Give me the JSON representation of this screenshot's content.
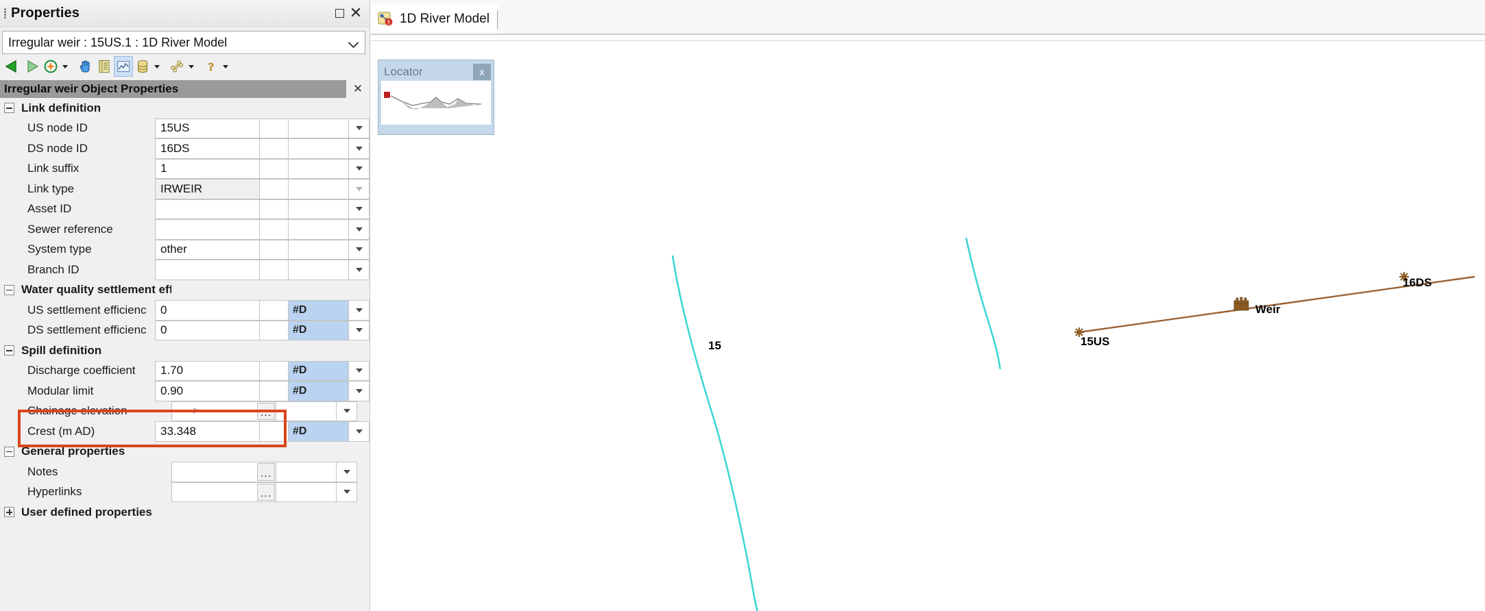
{
  "properties_panel": {
    "title": "Properties",
    "restore_icon": "restore-window-icon",
    "close_icon": "close-icon",
    "object_selector": {
      "value": "Irregular weir : 15US.1 : 1D River Model",
      "chevron_icon": "chevron-down-icon"
    },
    "toolbar": [
      {
        "name": "previous-object-button",
        "icon": "left-triangle-icon",
        "label": "Previous"
      },
      {
        "name": "next-object-button",
        "icon": "right-triangle-icon",
        "label": "Next"
      },
      {
        "name": "locate-object-button",
        "icon": "compass-icon",
        "label": "Locate"
      },
      {
        "name": "locate-dropdown",
        "icon": "chevron-down-icon",
        "label": ""
      },
      {
        "name": "select-object-button",
        "icon": "hand-pointer-icon",
        "label": "Select"
      },
      {
        "name": "open-form-button",
        "icon": "form-document-icon",
        "label": "Open form"
      },
      {
        "name": "graph-button",
        "icon": "graph-icon",
        "label": "Graph"
      },
      {
        "name": "database-button",
        "icon": "database-icon",
        "label": "Database"
      },
      {
        "name": "database-dropdown",
        "icon": "chevron-down-icon",
        "label": ""
      },
      {
        "name": "tools-button",
        "icon": "wrench-icon",
        "label": "Tools"
      },
      {
        "name": "tools-dropdown",
        "icon": "chevron-down-icon",
        "label": ""
      },
      {
        "name": "help-button",
        "icon": "help-question-icon",
        "label": "Help"
      },
      {
        "name": "help-dropdown",
        "icon": "chevron-down-icon",
        "label": ""
      }
    ],
    "object_properties_header": {
      "label": "Irregular weir Object Properties",
      "close_icon": "close-icon"
    },
    "highlight_color": "#d9461b",
    "badge_color": "#b9d3f0",
    "sections": [
      {
        "label": "Link definition",
        "expanded": true,
        "rows": [
          {
            "label": "US node ID",
            "value": "15US",
            "badge": "",
            "readonly": false,
            "ellipsis": false,
            "arrow": "enabled"
          },
          {
            "label": "DS node ID",
            "value": "16DS",
            "badge": "",
            "readonly": false,
            "ellipsis": false,
            "arrow": "enabled"
          },
          {
            "label": "Link suffix",
            "value": "1",
            "badge": "",
            "readonly": false,
            "ellipsis": false,
            "arrow": "enabled"
          },
          {
            "label": "Link type",
            "value": "IRWEIR",
            "badge": "",
            "readonly": true,
            "ellipsis": false,
            "arrow": "disabled"
          },
          {
            "label": "Asset ID",
            "value": "",
            "badge": "",
            "readonly": false,
            "ellipsis": false,
            "arrow": "enabled"
          },
          {
            "label": "Sewer reference",
            "value": "",
            "badge": "",
            "readonly": false,
            "ellipsis": false,
            "arrow": "enabled"
          },
          {
            "label": "System type",
            "value": "other",
            "badge": "",
            "readonly": false,
            "ellipsis": false,
            "arrow": "enabled"
          },
          {
            "label": "Branch ID",
            "value": "",
            "badge": "",
            "readonly": false,
            "ellipsis": false,
            "arrow": "enabled"
          }
        ]
      },
      {
        "label": "Water quality settlement efficiency",
        "expanded": true,
        "rows": [
          {
            "label": "US settlement efficienc",
            "value": "0",
            "badge": "#D",
            "readonly": false,
            "ellipsis": false,
            "arrow": "enabled"
          },
          {
            "label": "DS settlement efficienc",
            "value": "0",
            "badge": "#D",
            "readonly": false,
            "ellipsis": false,
            "arrow": "enabled"
          }
        ]
      },
      {
        "label": "Spill definition",
        "expanded": true,
        "rows": [
          {
            "label": "Discharge coefficient",
            "value": "1.70",
            "badge": "#D",
            "readonly": false,
            "ellipsis": false,
            "arrow": "enabled"
          },
          {
            "label": "Modular limit",
            "value": "0.90",
            "badge": "#D",
            "readonly": false,
            "ellipsis": false,
            "arrow": "enabled"
          },
          {
            "label": "Chainage elevation",
            "value": "---->",
            "badge": "",
            "readonly": false,
            "ellipsis": true,
            "arrow": "enabled",
            "grey": true
          },
          {
            "label": "Crest (m AD)",
            "value": "33.348",
            "badge": "#D",
            "readonly": false,
            "ellipsis": false,
            "arrow": "enabled"
          }
        ]
      },
      {
        "label": "General properties",
        "expanded": true,
        "rows": [
          {
            "label": "Notes",
            "value": "",
            "badge": "",
            "readonly": false,
            "ellipsis": true,
            "arrow": "enabled"
          },
          {
            "label": "Hyperlinks",
            "value": "",
            "badge": "",
            "readonly": false,
            "ellipsis": true,
            "arrow": "enabled"
          }
        ]
      },
      {
        "label": "User defined properties",
        "expanded": false,
        "rows": []
      }
    ]
  },
  "map_area": {
    "tab": {
      "label": "1D River Model",
      "icon": "network-model-icon"
    },
    "locator": {
      "title": "Locator",
      "close_label": "x",
      "close_icon": "close-icon"
    },
    "features": {
      "nodes": [
        {
          "id": "15US",
          "label": "15US"
        },
        {
          "id": "16DS",
          "label": "16DS"
        }
      ],
      "link_label": "Weir",
      "river_label": "15",
      "colors": {
        "link": "#9a6236",
        "river": "#3fd6d6",
        "weir_symbol": "#8a5a22",
        "node_marker": "#8a5a22"
      }
    }
  }
}
